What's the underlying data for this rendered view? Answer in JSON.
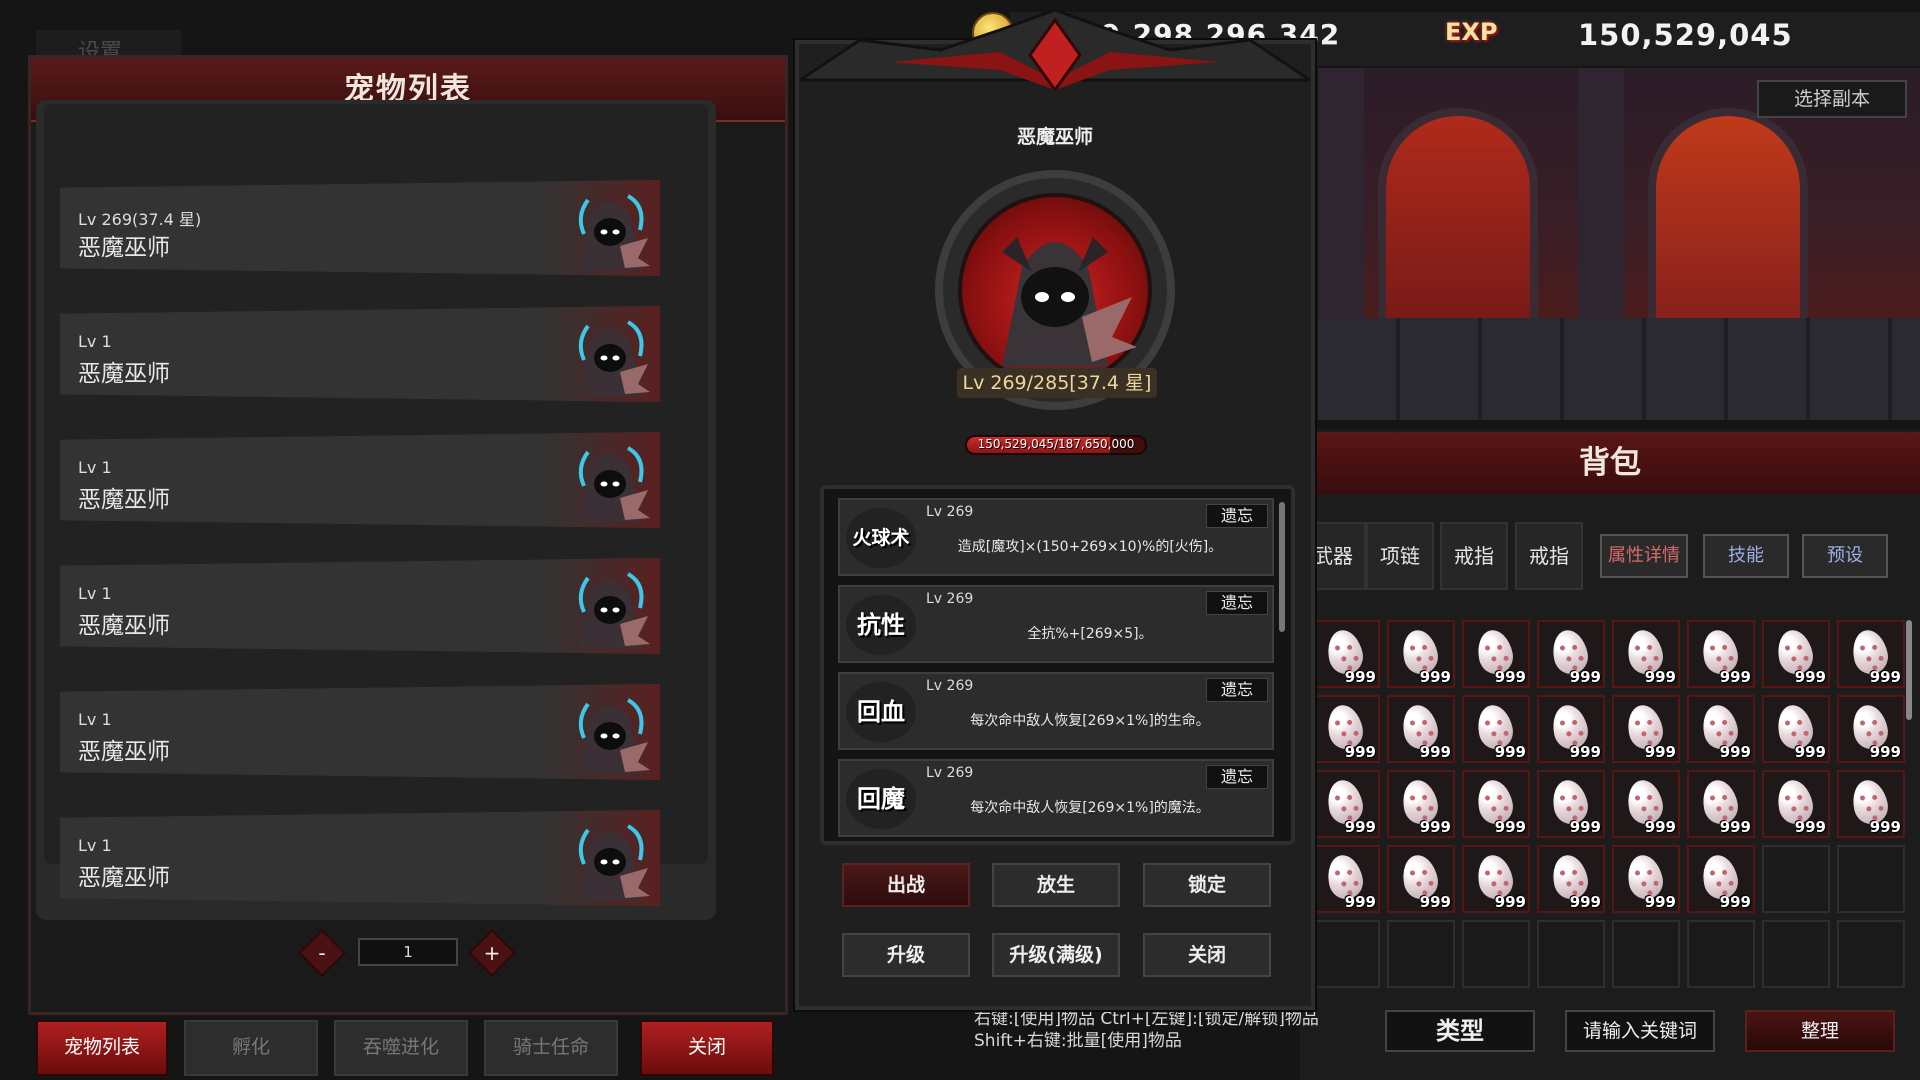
{
  "settings": {
    "label": "设置"
  },
  "pet_list": {
    "title": "宠物列表",
    "rows": [
      {
        "level": "Lv 269(37.4 星)",
        "name": "恶魔巫师"
      },
      {
        "level": "Lv 1",
        "name": "恶魔巫师"
      },
      {
        "level": "Lv 1",
        "name": "恶魔巫师"
      },
      {
        "level": "Lv 1",
        "name": "恶魔巫师"
      },
      {
        "level": "Lv 1",
        "name": "恶魔巫师"
      },
      {
        "level": "Lv 1",
        "name": "恶魔巫师"
      }
    ],
    "pagination": {
      "minus": "-",
      "page": "1",
      "plus": "+"
    }
  },
  "bottom_tabs": [
    "宠物列表",
    "孵化",
    "吞噬进化",
    "骑士任命",
    "关闭"
  ],
  "resources": {
    "gold": "29,298,296,342",
    "exp_label": "EXP",
    "exp": "150,529,045"
  },
  "scene": {
    "choose_stage": "选择副本"
  },
  "detail": {
    "name": "恶魔巫师",
    "level": "Lv 269/285[37.4 星]",
    "exp_text": "150,529,045/187,650,000",
    "exp_fraction": 0.802,
    "skills": [
      {
        "icon": "火球术",
        "level": "Lv 269",
        "forget": "遗忘",
        "desc": "造成[魔攻]×(150+269×10)%的[火伤]。"
      },
      {
        "icon": "抗性",
        "level": "Lv 269",
        "forget": "遗忘",
        "desc": "全抗%+[269×5]。"
      },
      {
        "icon": "回血",
        "level": "Lv 269",
        "forget": "遗忘",
        "desc": "每次命中敌人恢复[269×1%]的生命。"
      },
      {
        "icon": "回魔",
        "level": "Lv 269",
        "forget": "遗忘",
        "desc": "每次命中敌人恢复[269×1%]的魔法。"
      }
    ],
    "actions": {
      "deploy": "出战",
      "release": "放生",
      "lock": "锁定",
      "upgrade": "升级",
      "upgrade_max": "升级(满级)",
      "close": "关闭"
    }
  },
  "bag": {
    "title": "背包",
    "equip_tabs": [
      "武器",
      "项链",
      "戒指",
      "戒指"
    ],
    "attr_details": "属性详情",
    "skills": "技能",
    "preset": "预设",
    "item_count": "999",
    "filled_slots": 30,
    "hint_line1": "右键:[使用]物品 Ctrl+[左键]:[锁定/解锁]物品",
    "hint_line2": "Shift+右键:批量[使用]物品",
    "type_button": "类型",
    "search_placeholder": "请输入关键词",
    "sort_button": "整理"
  },
  "colors": {
    "accent_red": "#b02020",
    "gold": "#ecd89a"
  }
}
